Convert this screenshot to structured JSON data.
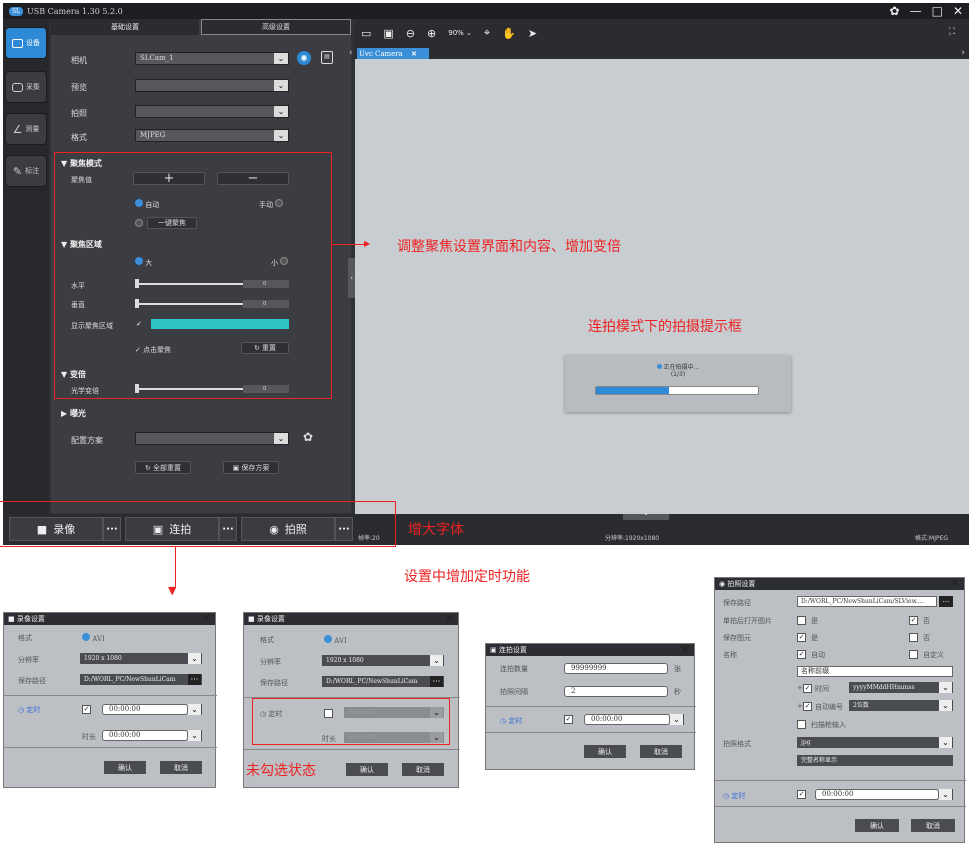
{
  "app": {
    "title": "USB Camera 1.30 5.2.0",
    "logo_text": "SL",
    "window_controls": [
      "✿",
      "—",
      "□",
      "✕"
    ]
  },
  "nav": {
    "items": [
      {
        "label": "设备",
        "active": true
      },
      {
        "label": "采集",
        "active": false
      },
      {
        "label": "测量",
        "active": false
      },
      {
        "label": "标注",
        "active": false
      }
    ]
  },
  "panel": {
    "tabs": {
      "basic": "基础设置",
      "advanced": "高级设置"
    },
    "camera_label": "相机",
    "camera_value": "SLCam_1",
    "preview_label": "预览",
    "preview_value": "",
    "snapshot_label": "拍照",
    "snapshot_value": "",
    "format_label": "格式",
    "format_value": "MJPEG",
    "focus_mode": {
      "header": "聚焦模式",
      "focus_value_label": "聚焦值",
      "auto_label": "自动",
      "manual_label": "手动",
      "one_click_label": "一键聚焦"
    },
    "focus_area": {
      "header": "聚焦区域",
      "large_label": "大",
      "small_label": "小",
      "horizontal_label": "水平",
      "horizontal_value": "0",
      "vertical_label": "垂直",
      "vertical_value": "0",
      "show_area_label": "显示聚焦区域",
      "click_focus_label": "点击聚焦",
      "reset_label": "重置"
    },
    "zoom": {
      "header": "变倍",
      "optical_label": "光学变倍",
      "optical_value": "0"
    },
    "exposure_header": "曝光",
    "profile_label": "配置方案",
    "profile_value": "",
    "reset_all_label": "全部重置",
    "save_profile_label": "保存方案",
    "accent_color": "#3a8fd8",
    "area_color": "#2ec4c4"
  },
  "view": {
    "zoom_text": "90%",
    "doc_tab": "Uvc Camera",
    "progress": {
      "title": "正在拍摄中...",
      "count": "(1/3)",
      "fraction": 0.45
    },
    "status_fps": "帧率:20",
    "status_resolution": "分辨率:1920x1080",
    "status_format": "格式:MJPEG"
  },
  "bottom": {
    "record_label": "录像",
    "burst_label": "连拍",
    "photo_label": "拍照"
  },
  "annotations": {
    "focus_note": "调整聚焦设置界面和内容、增加变倍",
    "burst_note": "连拍模式下的拍摄提示框",
    "font_note": "增大字体",
    "timer_note": "设置中增加定时功能",
    "unchecked_note": "未勾选状态",
    "annotation_color": "#e22222"
  },
  "record_dialog_1": {
    "title": "录像设置",
    "format_label": "格式",
    "format_value": "AVI",
    "resolution_label": "分辨率",
    "resolution_value": "1920 x 1080",
    "path_label": "保存路径",
    "path_value": "D:/WORL_PC/NewShunLiCam",
    "timer_label": "定时",
    "timer_value": "00:00:00",
    "duration_label": "时长",
    "duration_value": "00:00:00",
    "ok_label": "确认",
    "cancel_label": "取消"
  },
  "record_dialog_2": {
    "title": "录像设置",
    "format_label": "格式",
    "format_value": "AVI",
    "resolution_label": "分辨率",
    "resolution_value": "1920 x 1080",
    "path_label": "保存路径",
    "path_value": "D:/WORL_PC/NewShunLiCam",
    "timer_label": "定时",
    "timer_value": "00:00:00",
    "duration_label": "时长",
    "duration_value": "00:00:00",
    "ok_label": "确认",
    "cancel_label": "取消"
  },
  "burst_dialog": {
    "title": "连拍设置",
    "count_label": "连拍数量",
    "count_value": "99999999",
    "count_unit": "张",
    "interval_label": "拍照间隔",
    "interval_value": "2",
    "interval_unit": "秒",
    "timer_label": "定时",
    "timer_value": "00:00:00",
    "ok_label": "确认",
    "cancel_label": "取消"
  },
  "photo_dialog": {
    "title": "拍照设置",
    "path_label": "保存路径",
    "path_value": "D:/WORL_PC/NewShunLiCam/SLView....",
    "open_label": "单拍后打开图片",
    "yes_label": "是",
    "no_label": "否",
    "save_label": "保存图元",
    "name_label": "名称",
    "auto_label": "自动",
    "custom_label": "自定义",
    "prefix_value": "名称前缀",
    "time_label": "时间",
    "time_value": "yyyyMMddHHmmss",
    "number_label": "自动编号",
    "number_value": "2位数",
    "scan_label": "扫描枪输入",
    "format_label": "拍照格式",
    "format_value": "jpg",
    "full_name_label": "完整名称显示",
    "timer_label": "定时",
    "timer_value": "00:00:00",
    "ok_label": "确认",
    "cancel_label": "取消"
  }
}
